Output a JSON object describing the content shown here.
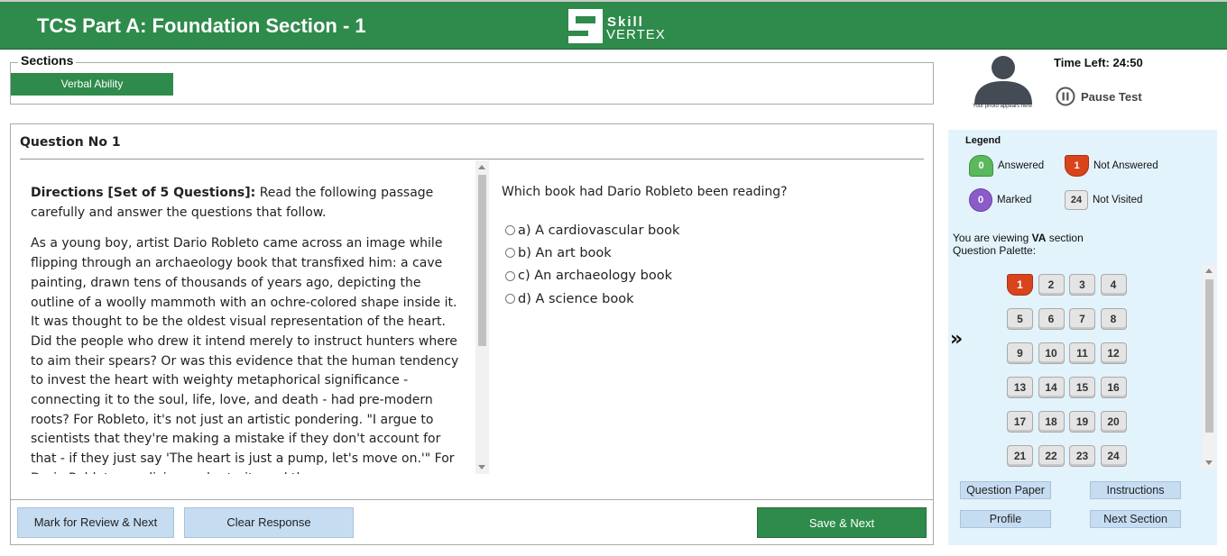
{
  "header": {
    "title": "TCS Part A: Foundation Section - 1",
    "logo_line1": "Skill",
    "logo_line2": "VERTEX"
  },
  "sections": {
    "legend": "Sections",
    "tabs": [
      {
        "label": "Verbal Ability",
        "active": true
      }
    ]
  },
  "question": {
    "number_label": "Question No 1",
    "directions_bold": "Directions [Set of 5 Questions]:",
    "directions_text": " Read the following passage carefully and answer the questions that follow.",
    "passage": "As a young boy, artist Dario Robleto came across an image while flipping through an archaeology book that transfixed him: a cave painting, drawn tens of thousands of years ago, depicting the outline of a woolly mammoth with an ochre-colored shape inside it. It was thought to be the oldest visual representation of the heart. Did the people who drew it intend merely to instruct hunters where to aim their spears? Or was this evidence that the human tendency to invest the heart with weighty metaphorical significance - connecting it to the soul, life, love, and death - had pre-modern roots? For Robleto, it's not just an artistic pondering. \"I argue to scientists that they're making a mistake if they don't account for that - if they just say 'The heart is just a pump, let's move on.'\" For Dario Robleto, medicine and art - its and the",
    "text": "Which book had Dario Robleto been reading?",
    "options": [
      "a) A cardiovascular book",
      "b) An art book",
      "c) An archaeology book",
      "d) A science book"
    ]
  },
  "actions": {
    "mark_review": "Mark for Review & Next",
    "clear": "Clear Response",
    "save_next": "Save & Next"
  },
  "candidate": {
    "photo_caption": "Your photo appears here",
    "time_left": "Time Left: 24:50",
    "pause": "Pause Test"
  },
  "legend": {
    "title": "Legend",
    "answered": {
      "count": "0",
      "label": "Answered"
    },
    "not_answered": {
      "count": "1",
      "label": "Not Answered"
    },
    "marked": {
      "count": "0",
      "label": "Marked"
    },
    "not_visited": {
      "count": "24",
      "label": "Not Visited"
    }
  },
  "palette": {
    "viewing_prefix": "You are viewing ",
    "viewing_section": "VA",
    "viewing_suffix": " section",
    "heading": "Question Palette:",
    "current": 1,
    "numbers": [
      "1",
      "2",
      "3",
      "4",
      "5",
      "6",
      "7",
      "8",
      "9",
      "10",
      "11",
      "12",
      "13",
      "14",
      "15",
      "16",
      "17",
      "18",
      "19",
      "20",
      "21",
      "22",
      "23",
      "24"
    ]
  },
  "side_buttons": {
    "question_paper": "Question Paper",
    "instructions": "Instructions",
    "profile": "Profile",
    "next_section": "Next Section"
  },
  "colors": {
    "brand_green": "#2e8b4b",
    "not_answered": "#d9441c",
    "answered": "#5cb85c",
    "marked": "#8a5cc8",
    "panel_bg": "#e3f3fb",
    "light_button": "#c6dcf1"
  }
}
